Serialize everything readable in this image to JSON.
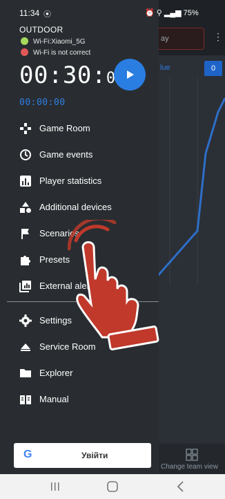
{
  "status_bar": {
    "time": "11:34",
    "right": "75%"
  },
  "background": {
    "input_text": "ay",
    "team_label": "lue",
    "team_score": "0",
    "change_team_label": "Change team view"
  },
  "drawer": {
    "mode": "OUTDOOR",
    "wifi": [
      {
        "label": "Wi-Fi:Xiaomi_5G",
        "color": "#a6d95e"
      },
      {
        "label": "Wi-Fi is not correct",
        "color": "#e05858"
      }
    ],
    "timer_main": "00:30:",
    "timer_main_small": "00",
    "timer_secondary": "00:00:00",
    "nav_items": [
      {
        "label": "Game Room",
        "icon": "gamepad-icon"
      },
      {
        "label": "Game events",
        "icon": "timer-icon"
      },
      {
        "label": "Player statistics",
        "icon": "bar-chart-icon"
      },
      {
        "label": "Additional devices",
        "icon": "shapes-icon"
      },
      {
        "label": "Scenarios",
        "icon": "flag-icon"
      },
      {
        "label": "Presets",
        "icon": "puzzle-icon"
      },
      {
        "label": "External alert",
        "icon": "external-alert-icon"
      },
      {
        "label": "Settings",
        "icon": "gear-icon"
      },
      {
        "label": "Service Room",
        "icon": "eject-icon"
      },
      {
        "label": "Explorer",
        "icon": "folder-icon"
      },
      {
        "label": "Manual",
        "icon": "book-icon"
      }
    ],
    "signin": {
      "label": "Увійти",
      "logo": "G"
    }
  },
  "colors": {
    "accent": "#2a7de1",
    "drawer_bg": "#292d31",
    "hand": "#c0392b"
  }
}
